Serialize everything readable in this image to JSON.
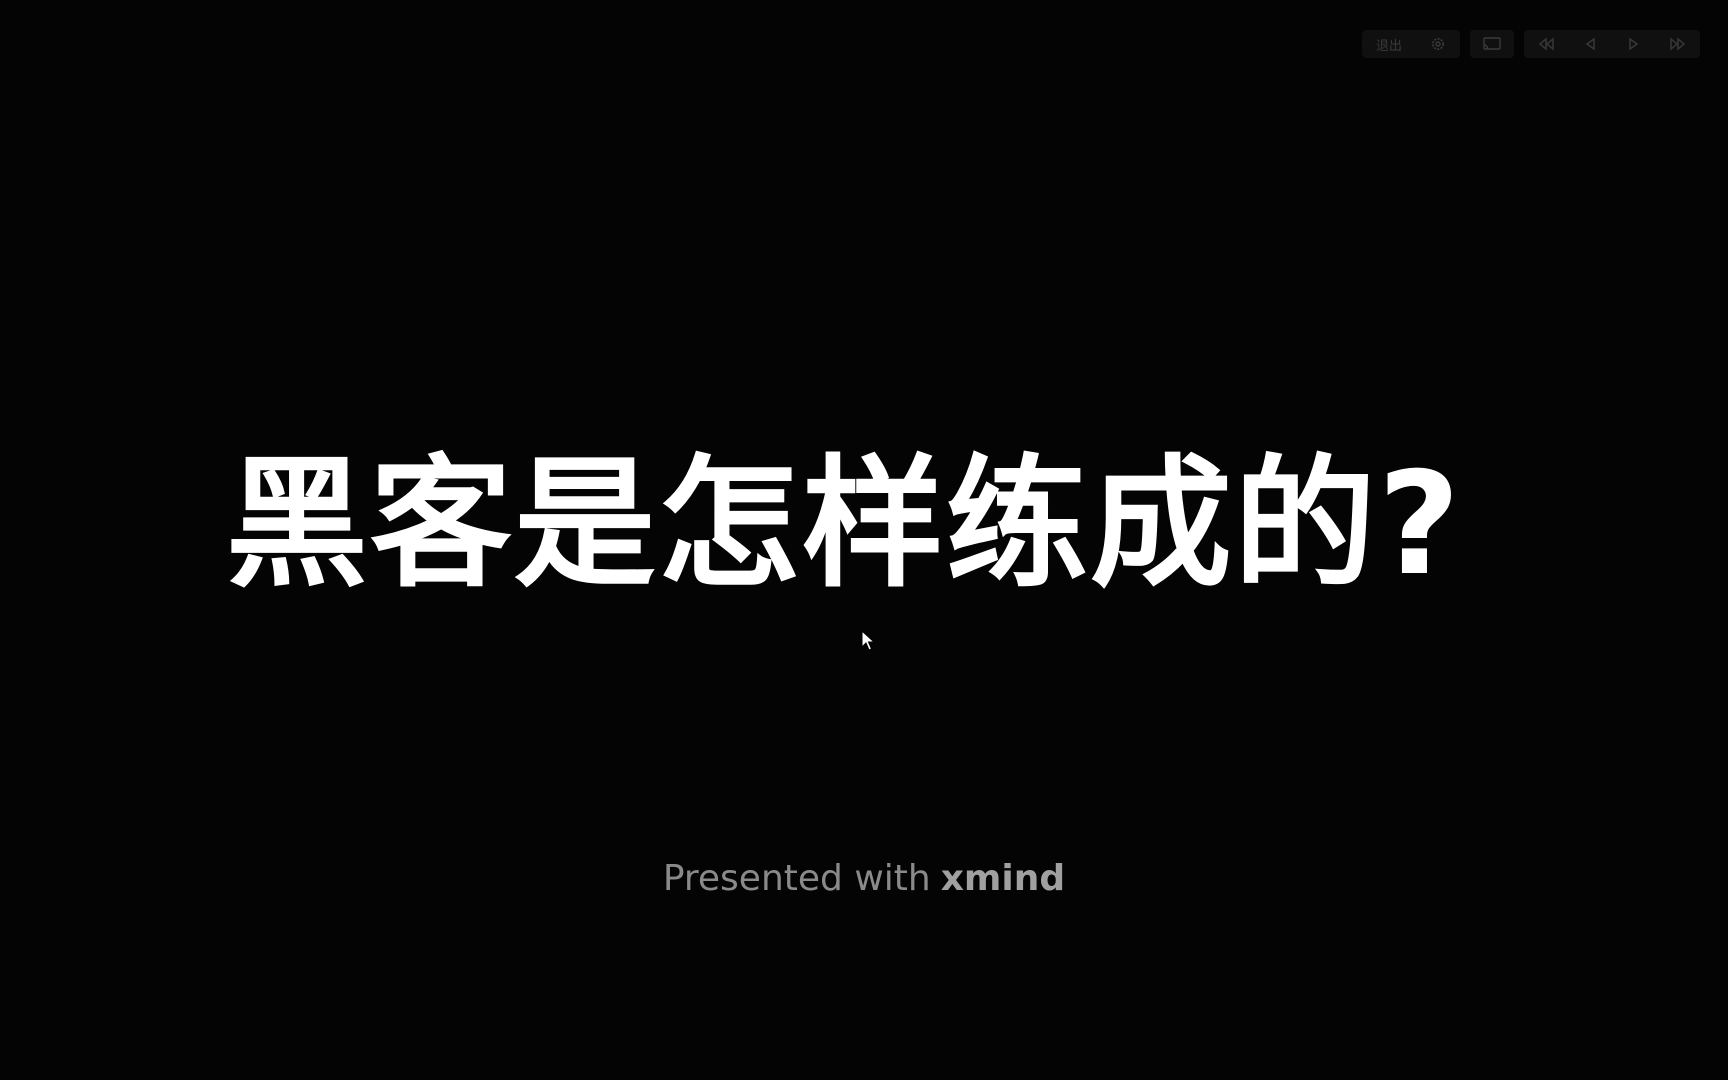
{
  "toolbar": {
    "exit_label": "退出",
    "buttons": [
      {
        "icon": "gear-icon"
      },
      {
        "icon": "cast-screen-icon"
      },
      {
        "icon": "first-slide-icon"
      },
      {
        "icon": "previous-slide-icon"
      },
      {
        "icon": "next-slide-icon"
      },
      {
        "icon": "last-slide-icon"
      }
    ]
  },
  "slide": {
    "title": "黑客是怎样练成的?"
  },
  "footer": {
    "prefix": "Presented with",
    "brand": "xmind"
  },
  "colors": {
    "background": "#040404",
    "title": "#ffffff",
    "footer_text": "#8a8a8a"
  }
}
